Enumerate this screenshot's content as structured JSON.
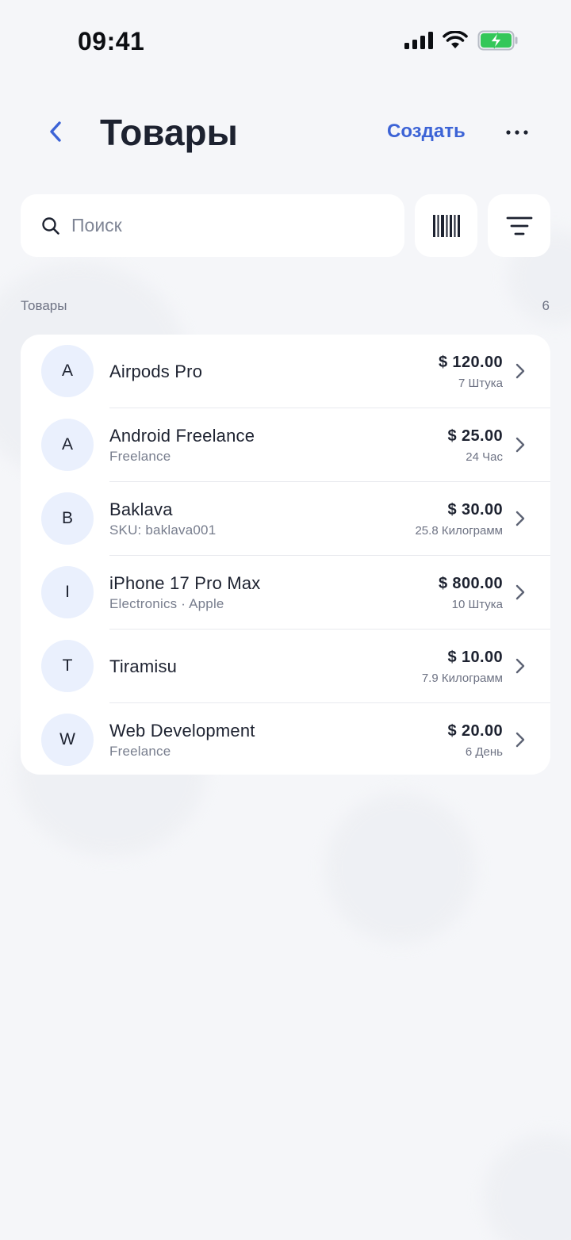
{
  "status_bar": {
    "time": "09:41",
    "icons": [
      "signal-icon",
      "wifi-icon",
      "battery-charging-icon"
    ]
  },
  "nav": {
    "back_icon": "chevron-left-icon",
    "title": "Товары",
    "create_label": "Создать",
    "more_icon": "ellipsis-icon"
  },
  "search": {
    "placeholder": "Поиск",
    "value": "",
    "icon": "search-icon"
  },
  "toolbar": {
    "barcode_icon": "barcode-icon",
    "filter_icon": "filter-icon"
  },
  "section": {
    "label": "Товары",
    "count": "6"
  },
  "items": [
    {
      "initial": "A",
      "name": "Airpods Pro",
      "subtitle": "",
      "price": "$ 120.00",
      "quantity": "7 Штука"
    },
    {
      "initial": "A",
      "name": "Android Freelance",
      "subtitle": "Freelance",
      "price": "$ 25.00",
      "quantity": "24 Час"
    },
    {
      "initial": "B",
      "name": "Baklava",
      "subtitle": "SKU: baklava001",
      "price": "$ 30.00",
      "quantity": "25.8 Килограмм"
    },
    {
      "initial": "I",
      "name": "iPhone 17 Pro Max",
      "subtitle": "Electronics · Apple",
      "price": "$ 800.00",
      "quantity": "10 Штука"
    },
    {
      "initial": "T",
      "name": "Tiramisu",
      "subtitle": "",
      "price": "$ 10.00",
      "quantity": "7.9 Килограмм"
    },
    {
      "initial": "W",
      "name": "Web Development",
      "subtitle": "Freelance",
      "price": "$ 20.00",
      "quantity": "6 День"
    }
  ],
  "colors": {
    "accent": "#3c63d6",
    "background": "#f5f6f9",
    "card": "#ffffff",
    "avatar_bg": "#eaf0fd",
    "battery_fill": "#34c759"
  }
}
